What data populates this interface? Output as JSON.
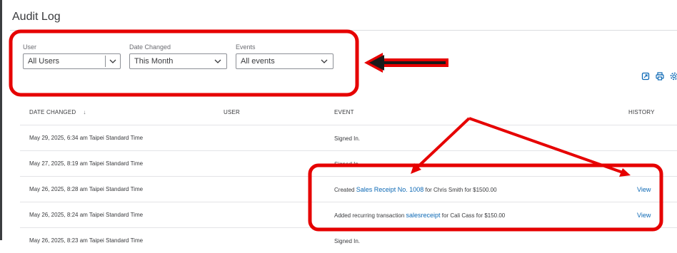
{
  "page": {
    "title": "Audit Log"
  },
  "filters": {
    "user": {
      "label": "User",
      "value": "All Users"
    },
    "date_changed": {
      "label": "Date Changed",
      "value": "This Month"
    },
    "events": {
      "label": "Events",
      "value": "All events"
    }
  },
  "toolbar": {
    "icons": [
      "export-icon",
      "print-icon",
      "settings-icon"
    ]
  },
  "table": {
    "headers": {
      "date_changed": "DATE CHANGED",
      "sort_indicator": "↓",
      "user": "USER",
      "event": "EVENT",
      "history": "HISTORY"
    },
    "rows": [
      {
        "date": "May 29, 2025, 6:34 am Taipei Standard Time",
        "user": "",
        "event_prefix": "Signed In.",
        "event_link": "",
        "event_suffix": "",
        "history": ""
      },
      {
        "date": "May 27, 2025, 8:19 am Taipei Standard Time",
        "user": "",
        "event_prefix": "Signed In.",
        "event_link": "",
        "event_suffix": "",
        "history": ""
      },
      {
        "date": "May 26, 2025, 8:28 am Taipei Standard Time",
        "user": "",
        "event_prefix": "Created ",
        "event_link": "Sales Receipt No. 1008",
        "event_suffix": " for Chris Smith for $1500.00",
        "history": "View"
      },
      {
        "date": "May 26, 2025, 8:24 am Taipei Standard Time",
        "user": "",
        "event_prefix": "Added recurring transaction ",
        "event_link": "salesreceipt",
        "event_suffix": " for Cali Cass for $150.00",
        "history": "View"
      },
      {
        "date": "May 26, 2025, 8:23 am Taipei Standard Time",
        "user": "",
        "event_prefix": "Signed In.",
        "event_link": "",
        "event_suffix": "",
        "history": ""
      }
    ]
  },
  "colors": {
    "annotation": "#e60000",
    "link": "#0d69b5",
    "text": "#393a3d"
  }
}
